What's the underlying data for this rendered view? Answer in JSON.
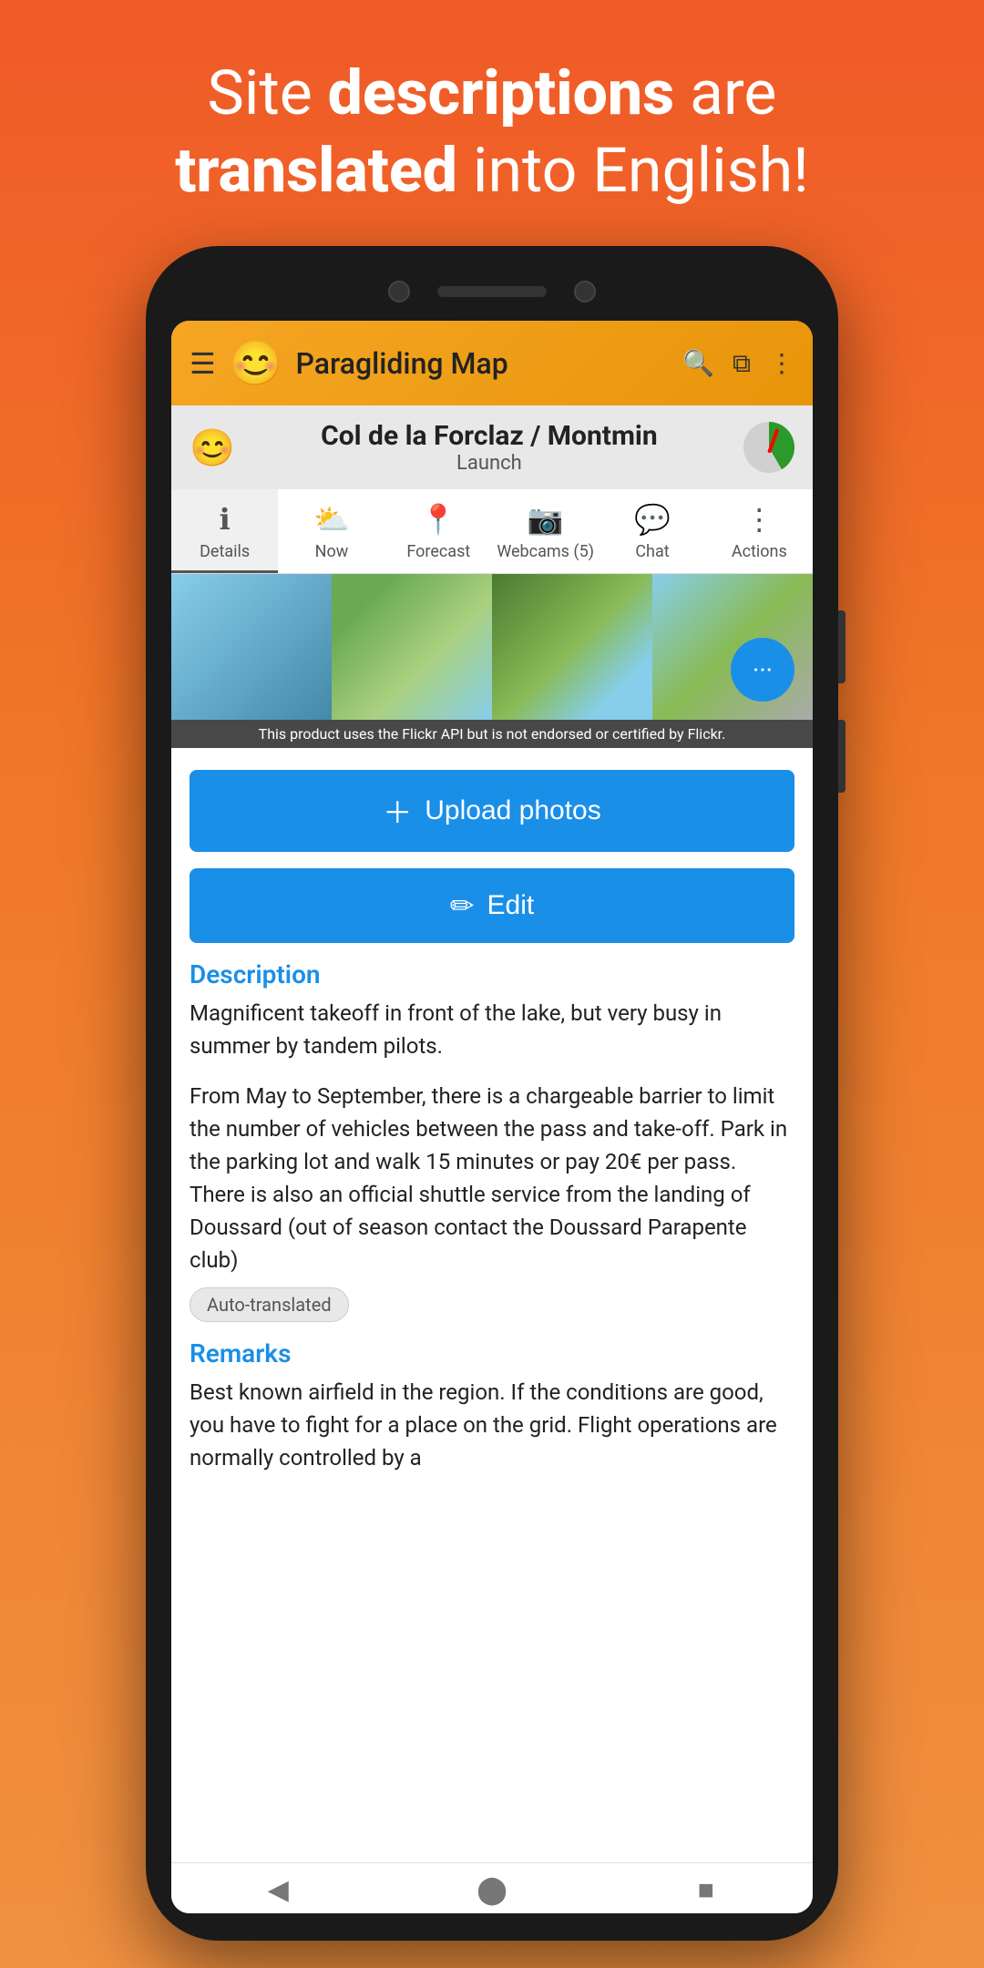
{
  "promo": {
    "line1": "Site ",
    "highlight1": "descriptions",
    "line2": " are",
    "highlight2": "translated",
    "line3": " into English!"
  },
  "appbar": {
    "title": "Paragliding Map",
    "menu_icon": "☰",
    "search_icon": "🔍",
    "layers_icon": "⧉",
    "more_icon": "⋮"
  },
  "site": {
    "name": "Col de la Forclaz / Montmin",
    "type": "Launch"
  },
  "tabs": [
    {
      "label": "Details",
      "icon": "ℹ"
    },
    {
      "label": "Now",
      "icon": "⛅"
    },
    {
      "label": "Forecast",
      "icon": "📍"
    },
    {
      "label": "Webcams (5)",
      "icon": "📷"
    },
    {
      "label": "Chat",
      "icon": "💬"
    },
    {
      "label": "Actions",
      "icon": "⋮"
    }
  ],
  "photos": {
    "flickr_notice": "This product uses the Flickr API but is not endorsed or certified by Flickr.",
    "more_label": "···"
  },
  "buttons": {
    "upload": "Upload photos",
    "edit": "Edit"
  },
  "description": {
    "title": "Description",
    "text1": "Magnificent takeoff in front of the lake, but very busy in summer by tandem pilots.",
    "text2": "From May to September, there is a chargeable barrier to limit the number of vehicles between the pass and take-off. Park in the parking lot and walk 15 minutes or pay 20€ per pass. There is also an official shuttle service from the landing of Doussard (out of season contact the Doussard Parapente club)",
    "badge": "Auto-translated"
  },
  "remarks": {
    "title": "Remarks",
    "text": "Best known airfield in the region. If the conditions are good, you have to fight for a place on the grid. Flight operations are normally controlled by a"
  },
  "bottom_nav": [
    {
      "icon": "◀",
      "label": ""
    },
    {
      "icon": "⬤",
      "label": ""
    },
    {
      "icon": "■",
      "label": ""
    }
  ]
}
